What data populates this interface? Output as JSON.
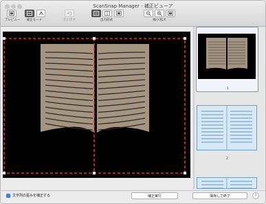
{
  "window": {
    "title": "ScanSnap Manager - 補正ビューア"
  },
  "toolbar": {
    "preview_label": "プレビュー",
    "correction_mode_label": "補正モード",
    "reset_label": "元に戻す",
    "output_format_label": "出力形式",
    "zoom_label": "縮小/拡大"
  },
  "thumbnails": {
    "page1": "1",
    "page2": "2"
  },
  "bottom": {
    "checkbox_label": "文字列の歪みを補正する",
    "checkbox_checked": true,
    "apply_button": "補正実行",
    "save_button": "保存して終了",
    "help_symbol": "?"
  },
  "colors": {
    "accent": "#3a7fe0",
    "selection_dash": "#e0302a",
    "page": "#a59480"
  }
}
